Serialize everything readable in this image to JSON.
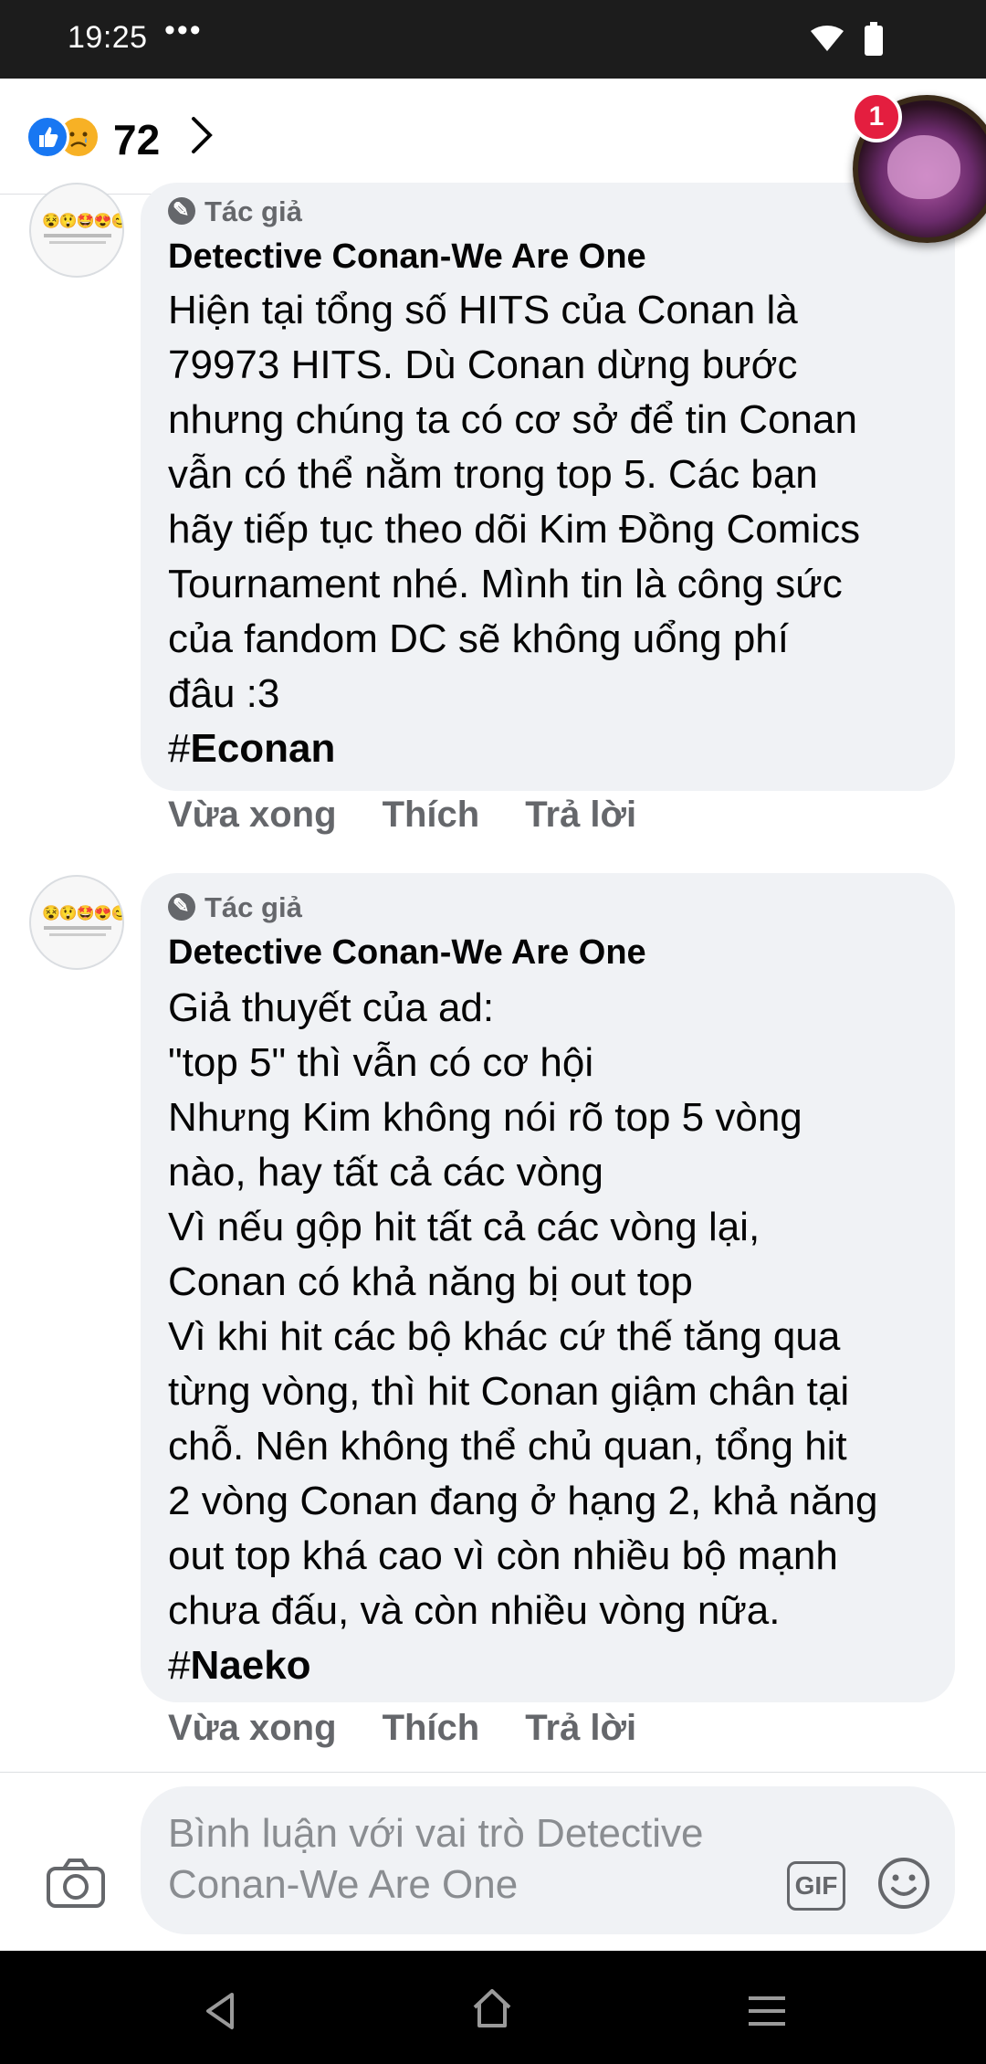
{
  "status_bar": {
    "time": "19:25",
    "dots": "•••"
  },
  "reactions": {
    "count": "72",
    "types": [
      "like-icon",
      "sad-icon"
    ]
  },
  "chat_head": {
    "badge_count": "1"
  },
  "comments": [
    {
      "author_badge": "Tác giả",
      "author": "Detective Conan-We Are One",
      "text": "Hiện tại tổng số HITS của Conan là\n79973 HITS. Dù Conan dừng bước\nnhưng chúng ta có cơ sở để tin Conan\nvẫn có thể nằm trong top 5. Các bạn\nhãy tiếp tục theo dõi Kim Đồng Comics\nTournament nhé. Mình tin là công sức\ncủa fandom DC sẽ không uổng phí\nđâu :3",
      "hashtag_prefix": "#",
      "hashtag": "Econan",
      "time": "Vừa xong",
      "like_label": "Thích",
      "reply_label": "Trả lời"
    },
    {
      "author_badge": "Tác giả",
      "author": "Detective Conan-We Are One",
      "text": "Giả thuyết của ad:\n\"top 5\" thì vẫn có cơ hội\nNhưng Kim không nói rõ top 5 vòng\nnào, hay tất cả các vòng\nVì nếu gộp hit tất cả các vòng lại,\nConan có khả năng bị out top\nVì khi hit các bộ khác cứ thế tăng qua\ntừng vòng, thì hit Conan giậm chân tại\nchỗ. Nên không thể chủ quan, tổng hit\n2 vòng Conan đang ở hạng 2, khả năng\nout top khá cao vì còn nhiều bộ mạnh\nchưa đấu, và còn nhiều vòng nữa.",
      "hashtag_prefix": "#",
      "hashtag": "Naeko",
      "time": "Vừa xong",
      "like_label": "Thích",
      "reply_label": "Trả lời"
    }
  ],
  "composer": {
    "placeholder": "Bình luận với vai trò Detective Conan-We Are One",
    "gif_label": "GIF"
  },
  "colors": {
    "like_blue": "#1877f2",
    "badge_red": "#e41e3f",
    "bubble_bg": "#f0f2f5",
    "muted_text": "#65676b"
  }
}
